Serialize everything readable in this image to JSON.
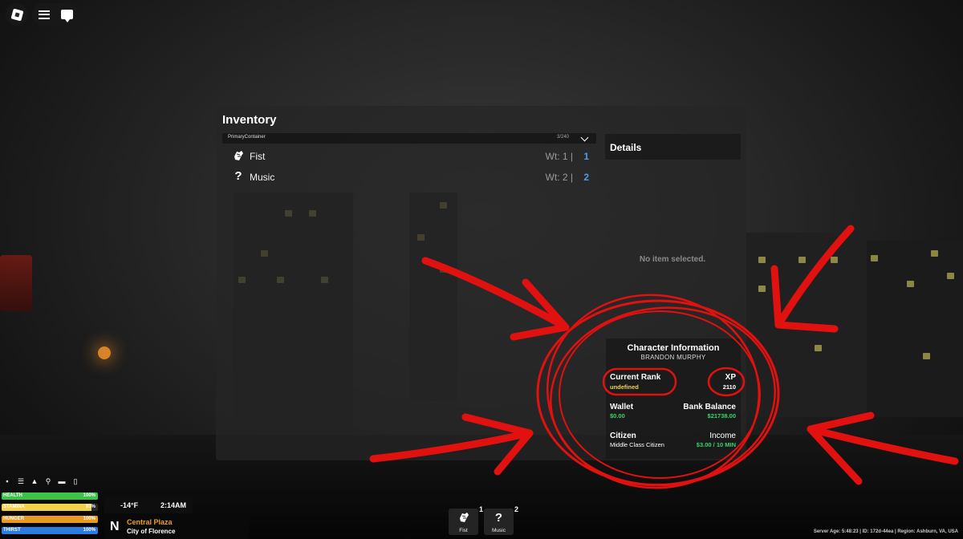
{
  "topbar": {
    "roblox_icon": "roblox-logo-icon",
    "menu_icon": "hamburger-menu-icon",
    "chat_icon": "chat-icon"
  },
  "inventory": {
    "title": "Inventory",
    "container": {
      "name": "PrimaryContainer",
      "count": "3/240",
      "toggle_icon": "chevron-down-icon"
    },
    "items": [
      {
        "name": "Fist",
        "weight": "Wt: 1 |",
        "qty": "1",
        "icon": "fist-icon"
      },
      {
        "name": "Music",
        "weight": "Wt: 2 |",
        "qty": "2",
        "icon": "question-mark-icon"
      }
    ],
    "details": {
      "title": "Details",
      "empty_text": "No item selected."
    }
  },
  "character": {
    "title": "Character Information",
    "name": "BRANDON MURPHY",
    "rank_label": "Current Rank",
    "rank_value": "undefined",
    "xp_label": "XP",
    "xp_value": "2110",
    "wallet_label": "Wallet",
    "wallet_value": "$0.00",
    "bank_label": "Bank Balance",
    "bank_value": "$21738.00",
    "citizen_label": "Citizen",
    "citizen_value": "Middle Class Citizen",
    "income_label": "Income",
    "income_value": "$3.00 / 10 MIN"
  },
  "hud": {
    "icons": [
      "backpack-icon",
      "list-icon",
      "car-icon",
      "running-icon",
      "bed-icon",
      "phone-icon"
    ],
    "stats": [
      {
        "label": "HEALTH",
        "pct": "100%",
        "level": 1.0,
        "color": "#3ec24a"
      },
      {
        "label": "STAMINA",
        "pct": "93%",
        "level": 0.93,
        "color": "#f2d24b"
      },
      {
        "label": "HUNGER",
        "pct": "100%",
        "level": 1.0,
        "color": "#e79a1e"
      },
      {
        "label": "THIRST",
        "pct": "100%",
        "level": 1.0,
        "color": "#2b7be0"
      }
    ],
    "temperature": "-14°F",
    "time": "2:14AM",
    "compass": "N",
    "location": "Central Plaza",
    "city": "City of Florence"
  },
  "hotbar": [
    {
      "label": "Fist",
      "num": "1",
      "icon": "fist-icon"
    },
    {
      "label": "Music",
      "num": "2",
      "icon": "question-mark-icon"
    }
  ],
  "server_info": "Server Age: 5:48:23 | ID: 172d-44ea | Region: Ashburn, VA, USA"
}
